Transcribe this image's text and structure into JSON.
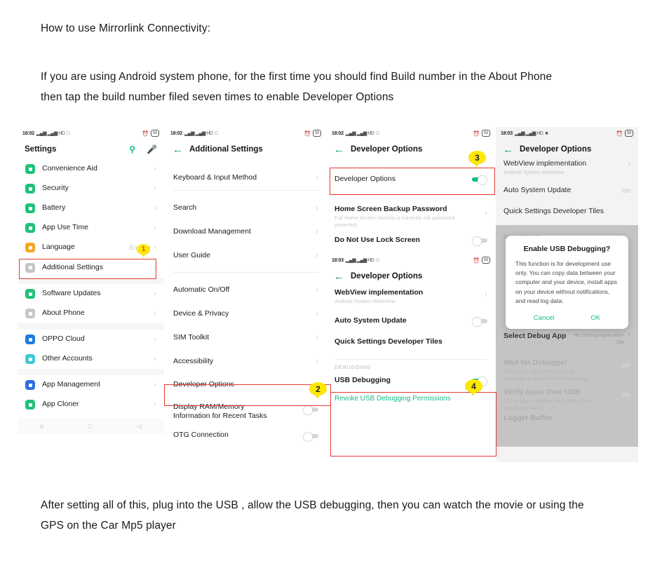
{
  "document": {
    "intro_1": "How to use Mirrorlink Connectivity:",
    "intro_2": "If you are using Android system phone, for the first time you should find Build number in the About Phone",
    "intro_3": "then tap the build number filed seven times to enable Developer Options",
    "outro_1": "After setting all of this, plug into the USB , allow the USB debugging, then you can watch the movie or using the",
    "outro_2": "GPS on the Car Mp5 player"
  },
  "colors": {
    "accent_green": "#0dbd8b",
    "link_green": "#17b98a",
    "highlight_red": "#e23b30",
    "badge_yellow": "#ffe800",
    "icon_orange": "#f5a623",
    "icon_blue": "#1f7ae0",
    "icon_teal": "#3fc8d8",
    "icon_grey": "#c6c6c6"
  },
  "phone1": {
    "status": {
      "time": "18:02",
      "signal": "▂▄▆ ▂▄▆ HD",
      "sim_box": "□",
      "alarm": "⏰",
      "battery": "93"
    },
    "title": "Settings",
    "search_icon": "search-icon",
    "mic_icon": "microphone-icon",
    "items": [
      {
        "label": "Convenience Aid",
        "color": "#21c17a",
        "value": "",
        "chevron": "›"
      },
      {
        "label": "Security",
        "color": "#21c17a",
        "value": "",
        "chevron": "›"
      },
      {
        "label": "Battery",
        "color": "#21c17a",
        "value": "",
        "chevron": "›"
      },
      {
        "label": "App Use Time",
        "color": "#21c17a",
        "value": "",
        "chevron": "›"
      },
      {
        "label": "Language",
        "color": "#f5a623",
        "value": "English",
        "chevron": "›"
      },
      {
        "label": "Additional Settings",
        "color": "#c6c6c6",
        "value": "",
        "chevron": "›"
      }
    ],
    "items2": [
      {
        "label": "Software Updates",
        "color": "#21c17a",
        "chevron": "›"
      },
      {
        "label": "About Phone",
        "color": "#c6c6c6",
        "chevron": "›"
      }
    ],
    "items3": [
      {
        "label": "OPPO Cloud",
        "color": "#1f7ae0",
        "chevron": "›"
      },
      {
        "label": "Other Accounts",
        "color": "#3fc8d8",
        "chevron": "›"
      }
    ],
    "items4": [
      {
        "label": "App Management",
        "color": "#2e6fe0",
        "chevron": "›"
      },
      {
        "label": "App Cloner",
        "color": "#21c17a",
        "chevron": "›"
      }
    ],
    "nav": {
      "recents": "≡",
      "home": "□",
      "back": "◁"
    }
  },
  "phone2": {
    "status": {
      "time": "18:02",
      "signal": "▂▄▆ ▂▄▆ HD",
      "sim_box": "□",
      "alarm": "⏰",
      "battery": "93"
    },
    "title": "Additional Settings",
    "back_icon": "back-arrow-icon",
    "group1": [
      {
        "label": "Keyboard & Input Method",
        "chevron": "›"
      }
    ],
    "group2": [
      {
        "label": "Search",
        "chevron": "›"
      },
      {
        "label": "Download Management",
        "chevron": "›"
      },
      {
        "label": "User Guide",
        "chevron": "›"
      }
    ],
    "group3": [
      {
        "label": "Automatic On/Off",
        "chevron": "›"
      },
      {
        "label": "Device & Privacy",
        "chevron": "›"
      },
      {
        "label": "SIM Toolkit",
        "chevron": "›"
      },
      {
        "label": "Accessibility",
        "chevron": "›"
      },
      {
        "label": "Developer Options",
        "chevron": "›"
      }
    ],
    "group4": [
      {
        "label": "Display RAM/Memory Information for Recent Tasks",
        "toggle": "off"
      },
      {
        "label": "OTG Connection",
        "toggle": "off"
      }
    ]
  },
  "phone3": {
    "status": {
      "time": "18:02",
      "signal": "▂▄▆ ▂▄▆ HD",
      "sim_box": "□",
      "alarm": "⏰",
      "battery": "93"
    },
    "title": "Developer Options",
    "top_items": [
      {
        "label": "Developer Options",
        "toggle": "on"
      }
    ],
    "items": [
      {
        "label": "Home Screen Backup Password",
        "sub": "Full Home Screen backup is currently not password protected",
        "chevron": "›"
      },
      {
        "label": "Do Not Use Lock Screen",
        "toggle": "off"
      }
    ],
    "status2": {
      "time": "18:03",
      "signal": "▂▄▆ ▂▄▆ HD",
      "sim_box": "□",
      "alarm": "⏰",
      "battery": "93"
    },
    "title2": "Developer Options",
    "items2": [
      {
        "label": "WebView implementation",
        "sub": "Android System WebView",
        "chevron": "›"
      },
      {
        "label": "Auto System Update",
        "toggle": "off"
      },
      {
        "label": "Quick Settings Developer Tiles",
        "chevron": ""
      }
    ],
    "debug_caption": "DEBUGGING",
    "debug_items": [
      {
        "label": "USB Debugging",
        "toggle": "on"
      }
    ],
    "revoke_link": "Revoke USB Debugging Permissions"
  },
  "phone4": {
    "status": {
      "time": "18:03",
      "signal": "▂▄▆ ▂▄▆ HD",
      "sim_box": "■",
      "alarm": "⏰",
      "battery": "93"
    },
    "title": "Developer Options",
    "items": [
      {
        "label": "WebView implementation",
        "sub": "Android System WebView",
        "chevron": "›"
      },
      {
        "label": "Auto System Update",
        "toggle": "off"
      },
      {
        "label": "Quick Settings Developer Tiles",
        "chevron": ""
      }
    ],
    "caption": "DEBUGGING",
    "dialog": {
      "title": "Enable USB Debugging?",
      "body": "This function is for development use only. You can copy data between your computer and your device, install apps on your device without notifications, and read log data.",
      "cancel": "Cancel",
      "ok": "OK"
    },
    "after_dialog": [
      {
        "label": "Select Debug App",
        "value": "No Debug Application Set",
        "chevron": "›",
        "ghost": false
      },
      {
        "label": "Wait for Debugger",
        "sub": "Debugged application waits for debugger to attach before executing",
        "toggle": "off",
        "ghost": true
      },
      {
        "label": "Verify Apps Over USB",
        "sub": "Check apps installed via ADB/ADT for harmful behavior",
        "toggle": "off",
        "ghost": true
      },
      {
        "label": "Logger Buffer",
        "sub": "",
        "chevron": "",
        "ghost": true
      }
    ],
    "nav": {
      "recents": "≡",
      "home": "□",
      "back": "◁"
    }
  },
  "callouts": [
    {
      "number": "1",
      "target": "additional-settings-row"
    },
    {
      "number": "2",
      "target": "developer-options-row"
    },
    {
      "number": "3",
      "target": "developer-options-toggle"
    },
    {
      "number": "4",
      "target": "usb-debugging-section"
    }
  ]
}
